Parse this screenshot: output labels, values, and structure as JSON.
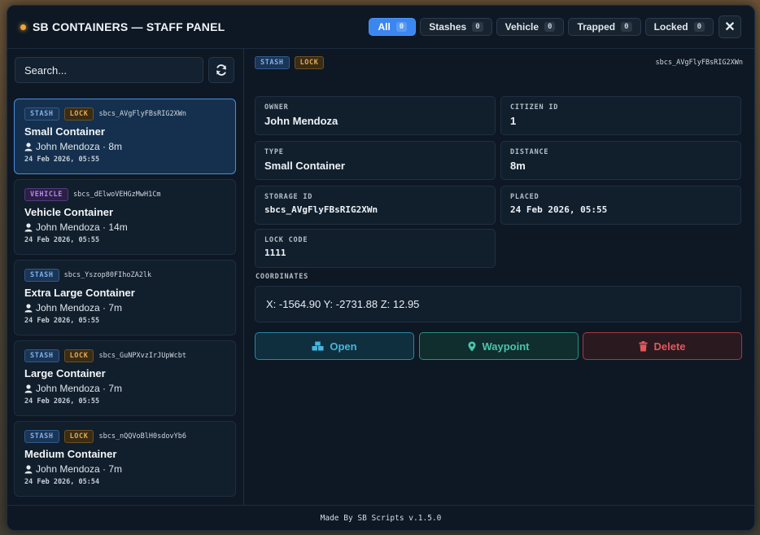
{
  "header": {
    "title": "SB CONTAINERS — STAFF PANEL",
    "filters": [
      {
        "label": "All",
        "count": "0"
      },
      {
        "label": "Stashes",
        "count": "0"
      },
      {
        "label": "Vehicle",
        "count": "0"
      },
      {
        "label": "Trapped",
        "count": "0"
      },
      {
        "label": "Locked",
        "count": "0"
      }
    ],
    "close_label": "✕"
  },
  "search": {
    "placeholder": "Search...",
    "refresh_icon": "refresh-icon"
  },
  "containers": [
    {
      "tags": [
        "STASH",
        "LOCK"
      ],
      "id": "sbcs_AVgFlyFBsRIG2XWn",
      "name": "Small Container",
      "meta": "John Mendoza · 8m",
      "date": "24 Feb 2026, 05:55"
    },
    {
      "tags": [
        "VEHICLE"
      ],
      "id": "sbcs_dElwoVEHGzMwH1Cm",
      "name": "Vehicle Container",
      "meta": "John Mendoza · 14m",
      "date": "24 Feb 2026, 05:55"
    },
    {
      "tags": [
        "STASH"
      ],
      "id": "sbcs_Yszop80FIhoZA2lk",
      "name": "Extra Large Container",
      "meta": "John Mendoza · 7m",
      "date": "24 Feb 2026, 05:55"
    },
    {
      "tags": [
        "STASH",
        "LOCK"
      ],
      "id": "sbcs_GuNPXvzIrJUpWcbt",
      "name": "Large Container",
      "meta": "John Mendoza · 7m",
      "date": "24 Feb 2026, 05:55"
    },
    {
      "tags": [
        "STASH",
        "LOCK"
      ],
      "id": "sbcs_nQQVoBlH0sdovYb6",
      "name": "Medium Container",
      "meta": "John Mendoza · 7m",
      "date": "24 Feb 2026, 05:54"
    }
  ],
  "detail": {
    "tags": [
      "STASH",
      "LOCK"
    ],
    "storage_id_top": "sbcs_AVgFlyFBsRIG2XWn",
    "fields": {
      "owner": {
        "label": "OWNER",
        "value": "John Mendoza"
      },
      "citizen_id": {
        "label": "CITIZEN ID",
        "value": "1"
      },
      "type": {
        "label": "TYPE",
        "value": "Small Container"
      },
      "distance": {
        "label": "DISTANCE",
        "value": "8m"
      },
      "storage_id": {
        "label": "STORAGE ID",
        "value": "sbcs_AVgFlyFBsRIG2XWn"
      },
      "placed": {
        "label": "PLACED",
        "value": "24 Feb 2026, 05:55"
      },
      "lock_code": {
        "label": "LOCK CODE",
        "value": "1111"
      }
    },
    "coordinates_label": "COORDINATES",
    "coordinates": "X: -1564.90 Y: -2731.88 Z: 12.95",
    "actions": {
      "open": "Open",
      "waypoint": "Waypoint",
      "delete": "Delete"
    }
  },
  "footer": "Made By SB Scripts v.1.5.0",
  "colors": {
    "accent": "#3b86f0",
    "open": "#48b6dc",
    "waypoint": "#4dc4ab",
    "delete": "#e2575b",
    "lock": "#e3aa55",
    "vehicle": "#b488e8",
    "status_dot": "#f0a43a"
  }
}
